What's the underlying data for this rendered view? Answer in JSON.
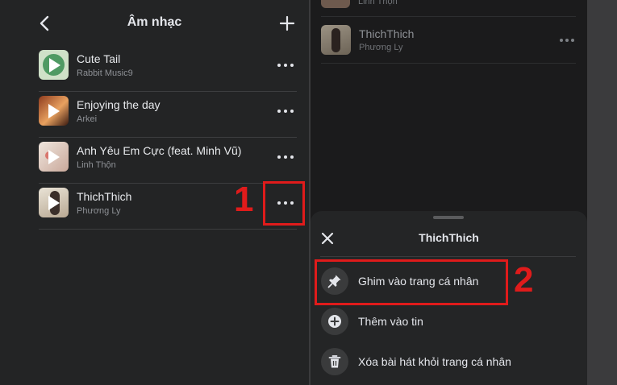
{
  "left_panel": {
    "title": "Âm nhạc",
    "back_icon": "chevron-left-icon",
    "add_icon": "plus-icon",
    "songs": [
      {
        "title": "Cute Tail",
        "artist": "Rabbit Music9"
      },
      {
        "title": "Enjoying the day",
        "artist": "Arkei"
      },
      {
        "title": "Anh Yêu Em Cực (feat. Minh Vũ)",
        "artist": "Linh Thộn"
      },
      {
        "title": "ThichThich",
        "artist": "Phương Ly"
      }
    ],
    "step_label": "1"
  },
  "right_panel": {
    "top_partial_artist": "Linh Thộn",
    "song": {
      "title": "ThichThich",
      "artist": "Phương Ly"
    },
    "sheet": {
      "title": "ThichThich",
      "options": [
        {
          "label": "Ghim vào trang cá nhân",
          "icon": "pin-icon"
        },
        {
          "label": "Thêm vào tin",
          "icon": "add-circle-icon"
        },
        {
          "label": "Xóa bài hát khỏi trang cá nhân",
          "icon": "trash-icon"
        }
      ]
    },
    "step_label": "2"
  },
  "colors": {
    "highlight": "#e01b1b",
    "background": "#232425"
  }
}
